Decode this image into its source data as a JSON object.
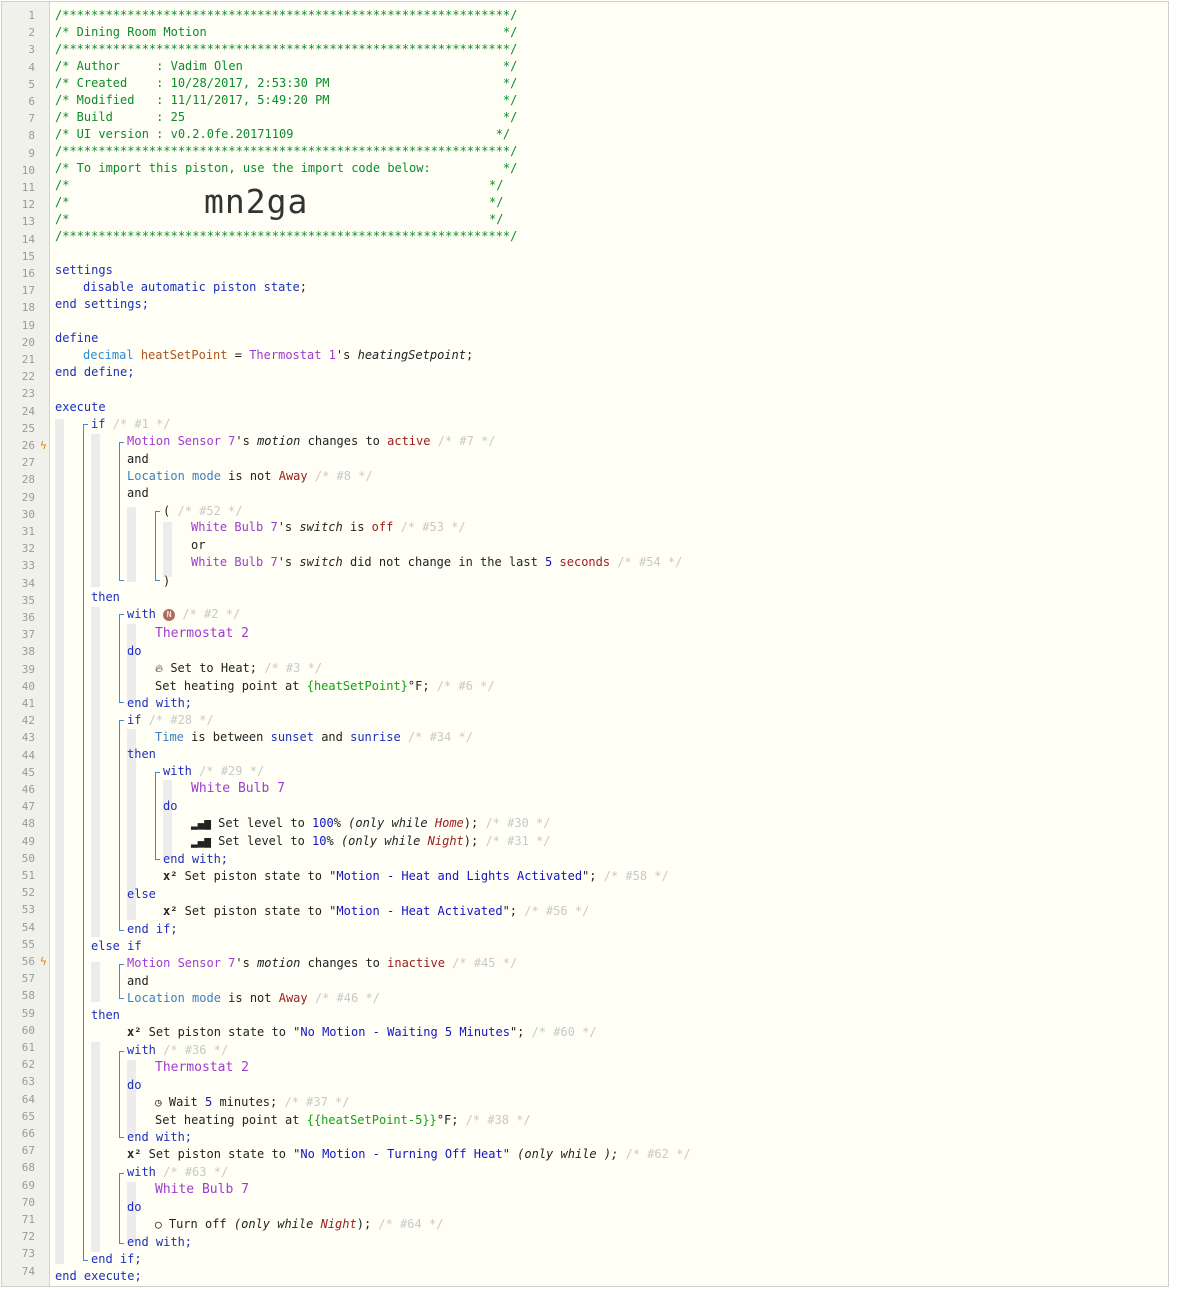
{
  "line_numbers": [
    1,
    2,
    3,
    4,
    5,
    6,
    7,
    8,
    9,
    10,
    11,
    12,
    13,
    14,
    15,
    16,
    17,
    18,
    19,
    20,
    21,
    22,
    23,
    24,
    25,
    26,
    27,
    28,
    29,
    30,
    31,
    32,
    33,
    34,
    35,
    36,
    37,
    38,
    39,
    40,
    41,
    42,
    43,
    44,
    45,
    46,
    47,
    48,
    49,
    50,
    51,
    52,
    53,
    54,
    55,
    56,
    57,
    58,
    59,
    60,
    61,
    62,
    63,
    64,
    65,
    66,
    67,
    68,
    69,
    70,
    71,
    72,
    73,
    74
  ],
  "trigger_lines": [
    26,
    56
  ],
  "header": {
    "stars": "/**************************************************************/",
    "title": "/* Dining Room Motion                                         */",
    "author": "/* Author     : Vadim Olen                                    */",
    "created": "/* Created    : 10/28/2017, 2:53:30 PM                        */",
    "modified": "/* Modified   : 11/11/2017, 5:49:20 PM                        */",
    "build": "/* Build      : 25                                            */",
    "ui_version": "/* UI version : v0.2.0fe.20171109                            */",
    "import_note": "/* To import this piston, use the import code below:          */",
    "blank_left": "/*",
    "blank_right": "*/",
    "import_code": "mn2ga"
  },
  "code": {
    "settings": "settings",
    "disable_state": "disable automatic piston state",
    "semicolon": ";",
    "end_settings": "end settings;",
    "define": "define",
    "decimal": "decimal",
    "var_name": "heatSetPoint",
    "eq": " = ",
    "thermostat_1": "Thermostat 1",
    "poss": "'s ",
    "heating_setpoint_attr": "heatingSetpoint",
    "end_define": "end define;",
    "execute": "execute",
    "if": "if",
    "c1": "/* #1 */",
    "motion_sensor_7": "Motion Sensor 7",
    "motion": "motion",
    "changes_to": " changes to ",
    "active": "active",
    "c7": "/* #7 */",
    "and": "and",
    "location_mode": "Location mode",
    "is_not": " is not ",
    "away": "Away",
    "c8": "/* #8 */",
    "paren_open": "(",
    "c52": "/* #52 */",
    "white_bulb_7": "White Bulb 7",
    "switch": "switch",
    "is": " is ",
    "off": "off",
    "c53": "/* #53 */",
    "or": "or",
    "did_not_change": " did not change in the last ",
    "five": "5",
    "seconds": "seconds",
    "c54": "/* #54 */",
    "paren_close": ")",
    "then": "then",
    "with": "with",
    "n_badge": "N",
    "c2": "/* #2 */",
    "thermostat_2": "Thermostat 2",
    "do": "do",
    "set_to_heat": "Set to Heat;",
    "c3": "/* #3 */",
    "set_heating_point_at": "Set heating point at ",
    "heat_expr": "{heatSetPoint}",
    "deg_f": "°F;",
    "c6": "/* #6 */",
    "end_with": "end with;",
    "c28": "/* #28 */",
    "time": "Time",
    "is_between": " is between ",
    "sunset": "sunset",
    "and_inline": " and ",
    "sunrise": "sunrise",
    "c34": "/* #34 */",
    "c29": "/* #29 */",
    "set_level_to": "Set level to ",
    "hundred": "100",
    "ten": "10",
    "percent": "% ",
    "only_while": "(only while ",
    "home": "Home",
    "night": "Night",
    "close_semi": ");",
    "c30": "/* #30 */",
    "c31": "/* #31 */",
    "x2": "x²",
    "set_piston_state_to": " Set piston state to \"",
    "state_heat_lights": "Motion - Heat and Lights Activated",
    "quote_semi": "\";",
    "c58": "/* #58 */",
    "else": "else",
    "state_heat": "Motion - Heat Activated",
    "c56": "/* #56 */",
    "end_if": "end if;",
    "else_if": "else if",
    "inactive": "inactive",
    "c45": "/* #45 */",
    "c46": "/* #46 */",
    "state_waiting_a": "No Motion - Waiting ",
    "state_waiting_b": " Minutes",
    "c60": "/* #60 */",
    "c36": "/* #36 */",
    "wait": "Wait ",
    "minutes": " minutes;",
    "c37": "/* #37 */",
    "heat_expr_minus": "{{heatSetPoint-5}}",
    "c38": "/* #38 */",
    "state_turning_off": "No Motion - Turning Off Heat",
    "quote_only_while_empty": "\" (only while );",
    "c62": "/* #62 */",
    "c63": "/* #63 */",
    "turn_off": "Turn off ",
    "c64": "/* #64 */",
    "end_execute": "end execute;"
  }
}
